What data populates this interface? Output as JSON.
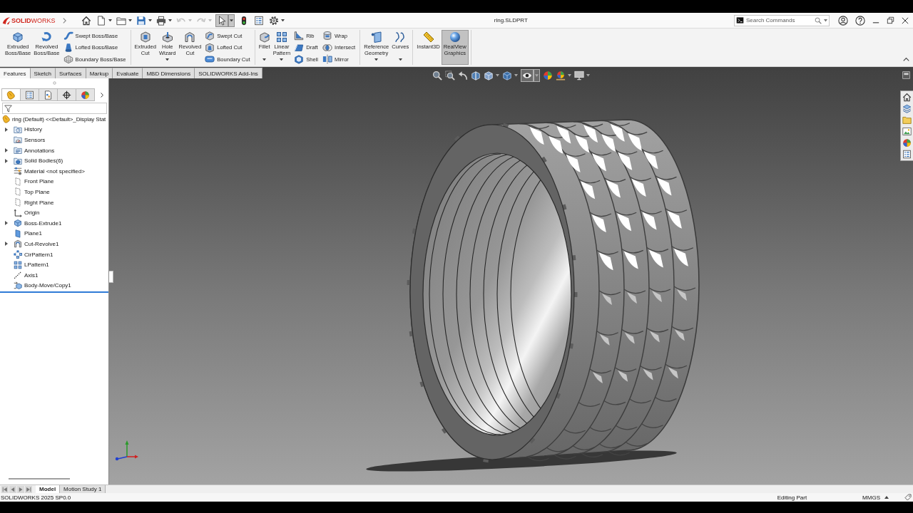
{
  "title_bar": {
    "logo": "**SOLID**WORKS",
    "quick_access": [
      {
        "kind": "home",
        "dropdown": false,
        "disabled": false,
        "pressed": false
      },
      {
        "kind": "new",
        "dropdown": true,
        "disabled": false,
        "pressed": false
      },
      {
        "kind": "open",
        "dropdown": true,
        "disabled": false,
        "pressed": false
      },
      {
        "kind": "save",
        "dropdown": true,
        "disabled": false,
        "pressed": false
      },
      {
        "kind": "print",
        "dropdown": true,
        "disabled": false,
        "pressed": false
      },
      {
        "kind": "undo",
        "dropdown": true,
        "disabled": true,
        "pressed": false
      },
      {
        "kind": "redo",
        "dropdown": true,
        "disabled": true,
        "pressed": false
      },
      {
        "kind": "select",
        "dropdown": true,
        "disabled": false,
        "pressed": true
      },
      {
        "kind": "rebuild",
        "dropdown": false,
        "disabled": false,
        "pressed": false
      },
      {
        "kind": "properties",
        "dropdown": false,
        "disabled": false,
        "pressed": false
      },
      {
        "kind": "options",
        "dropdown": true,
        "disabled": false,
        "pressed": false
      }
    ],
    "document": "ring.SLDPRT",
    "search": {
      "placeholder": "Search Commands"
    }
  },
  "ribbon": {
    "groups": [
      {
        "large": [
          {
            "kind": "extrude",
            "label": "Extruded Boss/Base",
            "dropdown": false,
            "pressed": false
          },
          {
            "kind": "revolve",
            "label": "Revolved Boss/Base",
            "dropdown": false,
            "pressed": false
          }
        ],
        "stacks": [
          [
            {
              "kind": "swept",
              "label": "Swept Boss/Base"
            },
            {
              "kind": "loft",
              "label": "Lofted Boss/Base"
            },
            {
              "kind": "boundary",
              "label": "Boundary Boss/Base"
            }
          ]
        ]
      },
      {
        "large": [
          {
            "kind": "extrude_cut",
            "label": "Extruded Cut",
            "dropdown": false,
            "pressed": false
          },
          {
            "kind": "hole",
            "label": "Hole Wizard",
            "dropdown": true,
            "pressed": false
          },
          {
            "kind": "revolve_cut",
            "label": "Revolved Cut",
            "dropdown": false,
            "pressed": false
          }
        ],
        "stacks": [
          [
            {
              "kind": "swept_cut",
              "label": "Swept Cut"
            },
            {
              "kind": "loft_cut",
              "label": "Lofted Cut"
            },
            {
              "kind": "boundary_cut",
              "label": "Boundary Cut"
            }
          ]
        ]
      },
      {
        "large": [
          {
            "kind": "fillet",
            "label": "Fillet",
            "dropdown": true,
            "pressed": false
          },
          {
            "kind": "linear_pattern",
            "label": "Linear Pattern",
            "dropdown": true,
            "pressed": false
          }
        ],
        "stacks": [
          [
            {
              "kind": "rib",
              "label": "Rib"
            },
            {
              "kind": "draft",
              "label": "Draft"
            },
            {
              "kind": "shell",
              "label": "Shell"
            }
          ],
          [
            {
              "kind": "wrap",
              "label": "Wrap"
            },
            {
              "kind": "intersect",
              "label": "Intersect"
            },
            {
              "kind": "mirror",
              "label": "Mirror"
            }
          ]
        ]
      },
      {
        "large": [
          {
            "kind": "refgeom",
            "label": "Reference Geometry",
            "dropdown": true,
            "pressed": false
          },
          {
            "kind": "curves",
            "label": "Curves",
            "dropdown": true,
            "pressed": false
          }
        ]
      },
      {
        "large": [
          {
            "kind": "instant3d",
            "label": "Instant3D",
            "dropdown": false,
            "pressed": false
          },
          {
            "kind": "realview",
            "label": "RealView Graphics",
            "dropdown": false,
            "pressed": true
          }
        ]
      }
    ]
  },
  "command_tabs": [
    {
      "label": "Features",
      "selected": true
    },
    {
      "label": "Sketch",
      "selected": false
    },
    {
      "label": "Surfaces",
      "selected": false
    },
    {
      "label": "Markup",
      "selected": false
    },
    {
      "label": "Evaluate",
      "selected": false
    },
    {
      "label": "MBD Dimensions",
      "selected": false
    },
    {
      "label": "SOLIDWORKS Add-Ins",
      "selected": false
    }
  ],
  "view_toolbar": [
    {
      "kind": "zoom_fit",
      "dropdown": false,
      "pressed": false
    },
    {
      "kind": "zoom_area",
      "dropdown": false,
      "pressed": false
    },
    {
      "kind": "previous_view",
      "dropdown": false,
      "pressed": false
    },
    {
      "kind": "section_view",
      "dropdown": false,
      "pressed": false
    },
    {
      "kind": "view_orientation",
      "dropdown": true,
      "pressed": false
    },
    {
      "kind": "display_style",
      "dropdown": true,
      "pressed": false
    },
    {
      "kind": "hide_show",
      "dropdown": true,
      "pressed": true
    },
    {
      "kind": "appearance",
      "dropdown": false,
      "pressed": false
    },
    {
      "kind": "scene",
      "dropdown": true,
      "pressed": false
    },
    {
      "kind": "view_settings",
      "dropdown": true,
      "pressed": false
    }
  ],
  "feature_manager": {
    "tabs": [
      {
        "kind": "feature_tree",
        "selected": true
      },
      {
        "kind": "property_manager",
        "selected": false
      },
      {
        "kind": "configuration_manager",
        "selected": false
      },
      {
        "kind": "dimxpert",
        "selected": false
      },
      {
        "kind": "display_manager",
        "selected": false
      }
    ],
    "root": "ring (Default) <<Default>_Display Stat",
    "items": [
      {
        "kind": "history",
        "label": "History",
        "expandable": true
      },
      {
        "kind": "sensors",
        "label": "Sensors",
        "expandable": false
      },
      {
        "kind": "annotations",
        "label": "Annotations",
        "expandable": true
      },
      {
        "kind": "bodies",
        "label": "Solid Bodies(6)",
        "expandable": true
      },
      {
        "kind": "material",
        "label": "Material <not specified>",
        "expandable": false
      },
      {
        "kind": "plane",
        "label": "Front Plane",
        "expandable": false
      },
      {
        "kind": "plane",
        "label": "Top Plane",
        "expandable": false
      },
      {
        "kind": "plane",
        "label": "Right Plane",
        "expandable": false
      },
      {
        "kind": "origin",
        "label": "Origin",
        "expandable": false
      },
      {
        "kind": "extrude",
        "label": "Boss-Extrude1",
        "expandable": true
      },
      {
        "kind": "ref_plane",
        "label": "Plane1",
        "expandable": false
      },
      {
        "kind": "revolve_cut",
        "label": "Cut-Revolve1",
        "expandable": true
      },
      {
        "kind": "circular_pattern",
        "label": "CirPattern1",
        "expandable": false
      },
      {
        "kind": "linear_pattern",
        "label": "LPattern1",
        "expandable": false
      },
      {
        "kind": "axis",
        "label": "Axis1",
        "expandable": false
      },
      {
        "kind": "move_copy",
        "label": "Body-Move/Copy1",
        "expandable": false
      }
    ]
  },
  "task_pane": [
    {
      "kind": "home"
    },
    {
      "kind": "design_library"
    },
    {
      "kind": "file_explorer"
    },
    {
      "kind": "view_palette"
    },
    {
      "kind": "appearances"
    },
    {
      "kind": "custom_properties"
    }
  ],
  "bottom_tabs": [
    {
      "label": "Model",
      "selected": true
    },
    {
      "label": "Motion Study 1",
      "selected": false
    }
  ],
  "status_bar": {
    "version": "SOLIDWORKS 2025 SP0.0",
    "mode": "Editing Part",
    "units": "MMGS"
  }
}
